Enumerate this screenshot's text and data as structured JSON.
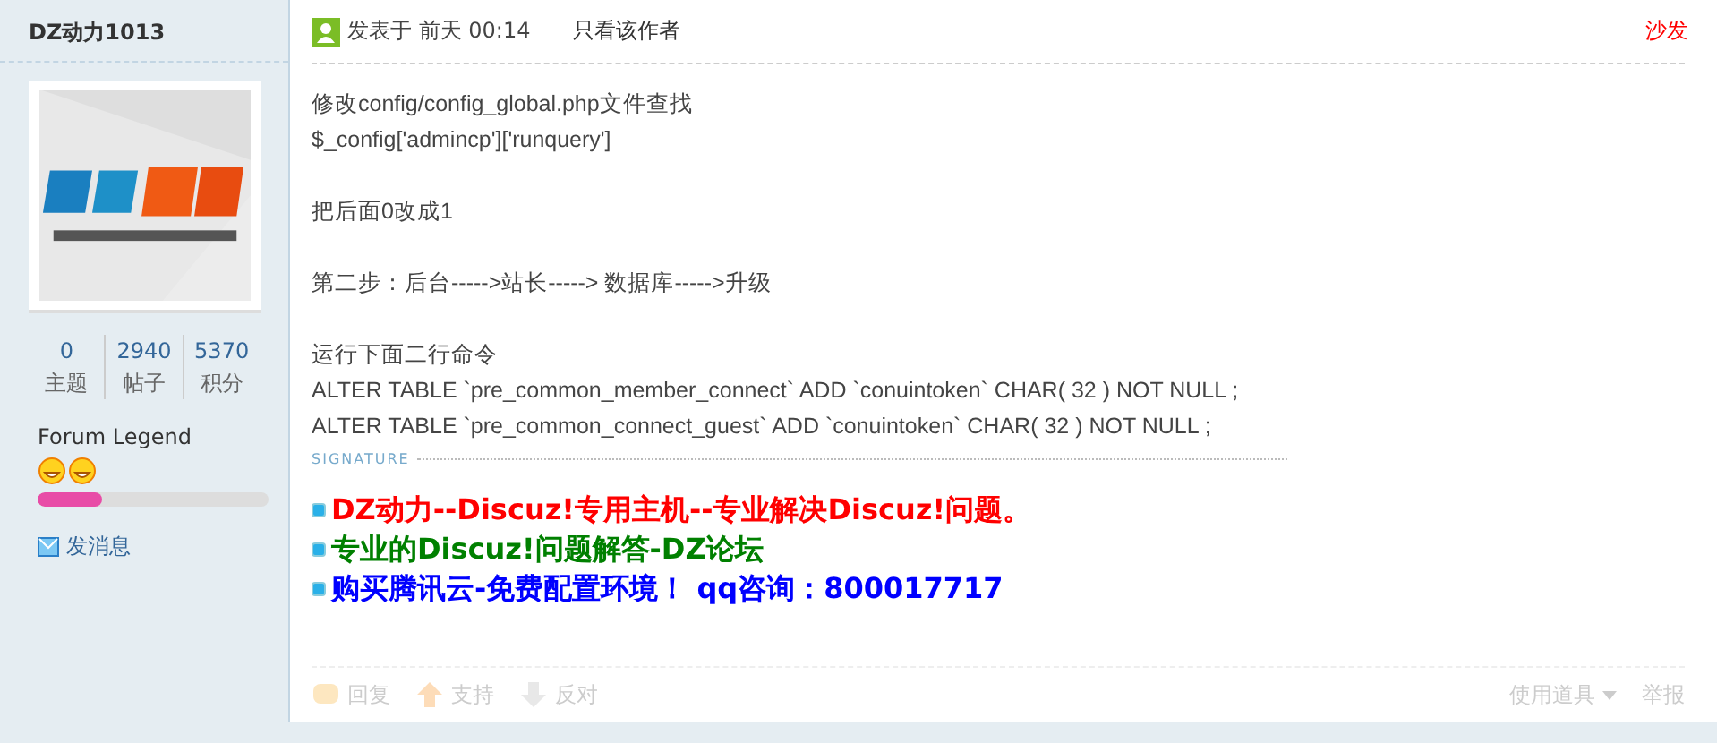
{
  "author": {
    "name": "DZ动力1013",
    "stats": [
      {
        "value": "0",
        "label": "主题"
      },
      {
        "value": "2940",
        "label": "帖子"
      },
      {
        "value": "5370",
        "label": "积分"
      }
    ],
    "rank": "Forum Legend",
    "rank_icons": [
      {
        "kind": "smiley"
      },
      {
        "kind": "smiley"
      }
    ],
    "progress": {
      "level": 0.28
    },
    "message_link": "发消息"
  },
  "post": {
    "posted": "发表于 前天 00:14",
    "only_author": "只看该作者",
    "floor": "沙发",
    "paragraphs": [
      [
        "修改config/config_global.php文件查找",
        "$_config['admincp']['runquery']"
      ],
      [
        "把后面0改成1"
      ],
      [
        "第二步：后台----->站长-----> 数据库----->升级"
      ],
      [
        "运行下面二行命令",
        "ALTER TABLE  `pre_common_member_connect` ADD  `conuintoken` CHAR( 32 ) NOT NULL ;",
        "ALTER TABLE  `pre_common_connect_guest` ADD  `conuintoken` CHAR( 32 ) NOT NULL ;"
      ]
    ],
    "signature_label": "SIGNATURE",
    "signature": [
      {
        "text": "DZ动力--Discuz!专用主机--专业解决Discuz!问题。",
        "color": "#ff0000"
      },
      {
        "text": "专业的Discuz!问题解答-DZ论坛",
        "color": "#008000"
      },
      {
        "text": "购买腾讯云-免费配置环境！ qq咨询：800017717",
        "color": "#0000ff"
      }
    ],
    "actions": [
      {
        "label": "回复",
        "kind": "reply"
      },
      {
        "label": "支持",
        "kind": "up"
      },
      {
        "label": "反对",
        "kind": "down"
      }
    ],
    "tools": "使用道具",
    "report": "举报"
  }
}
